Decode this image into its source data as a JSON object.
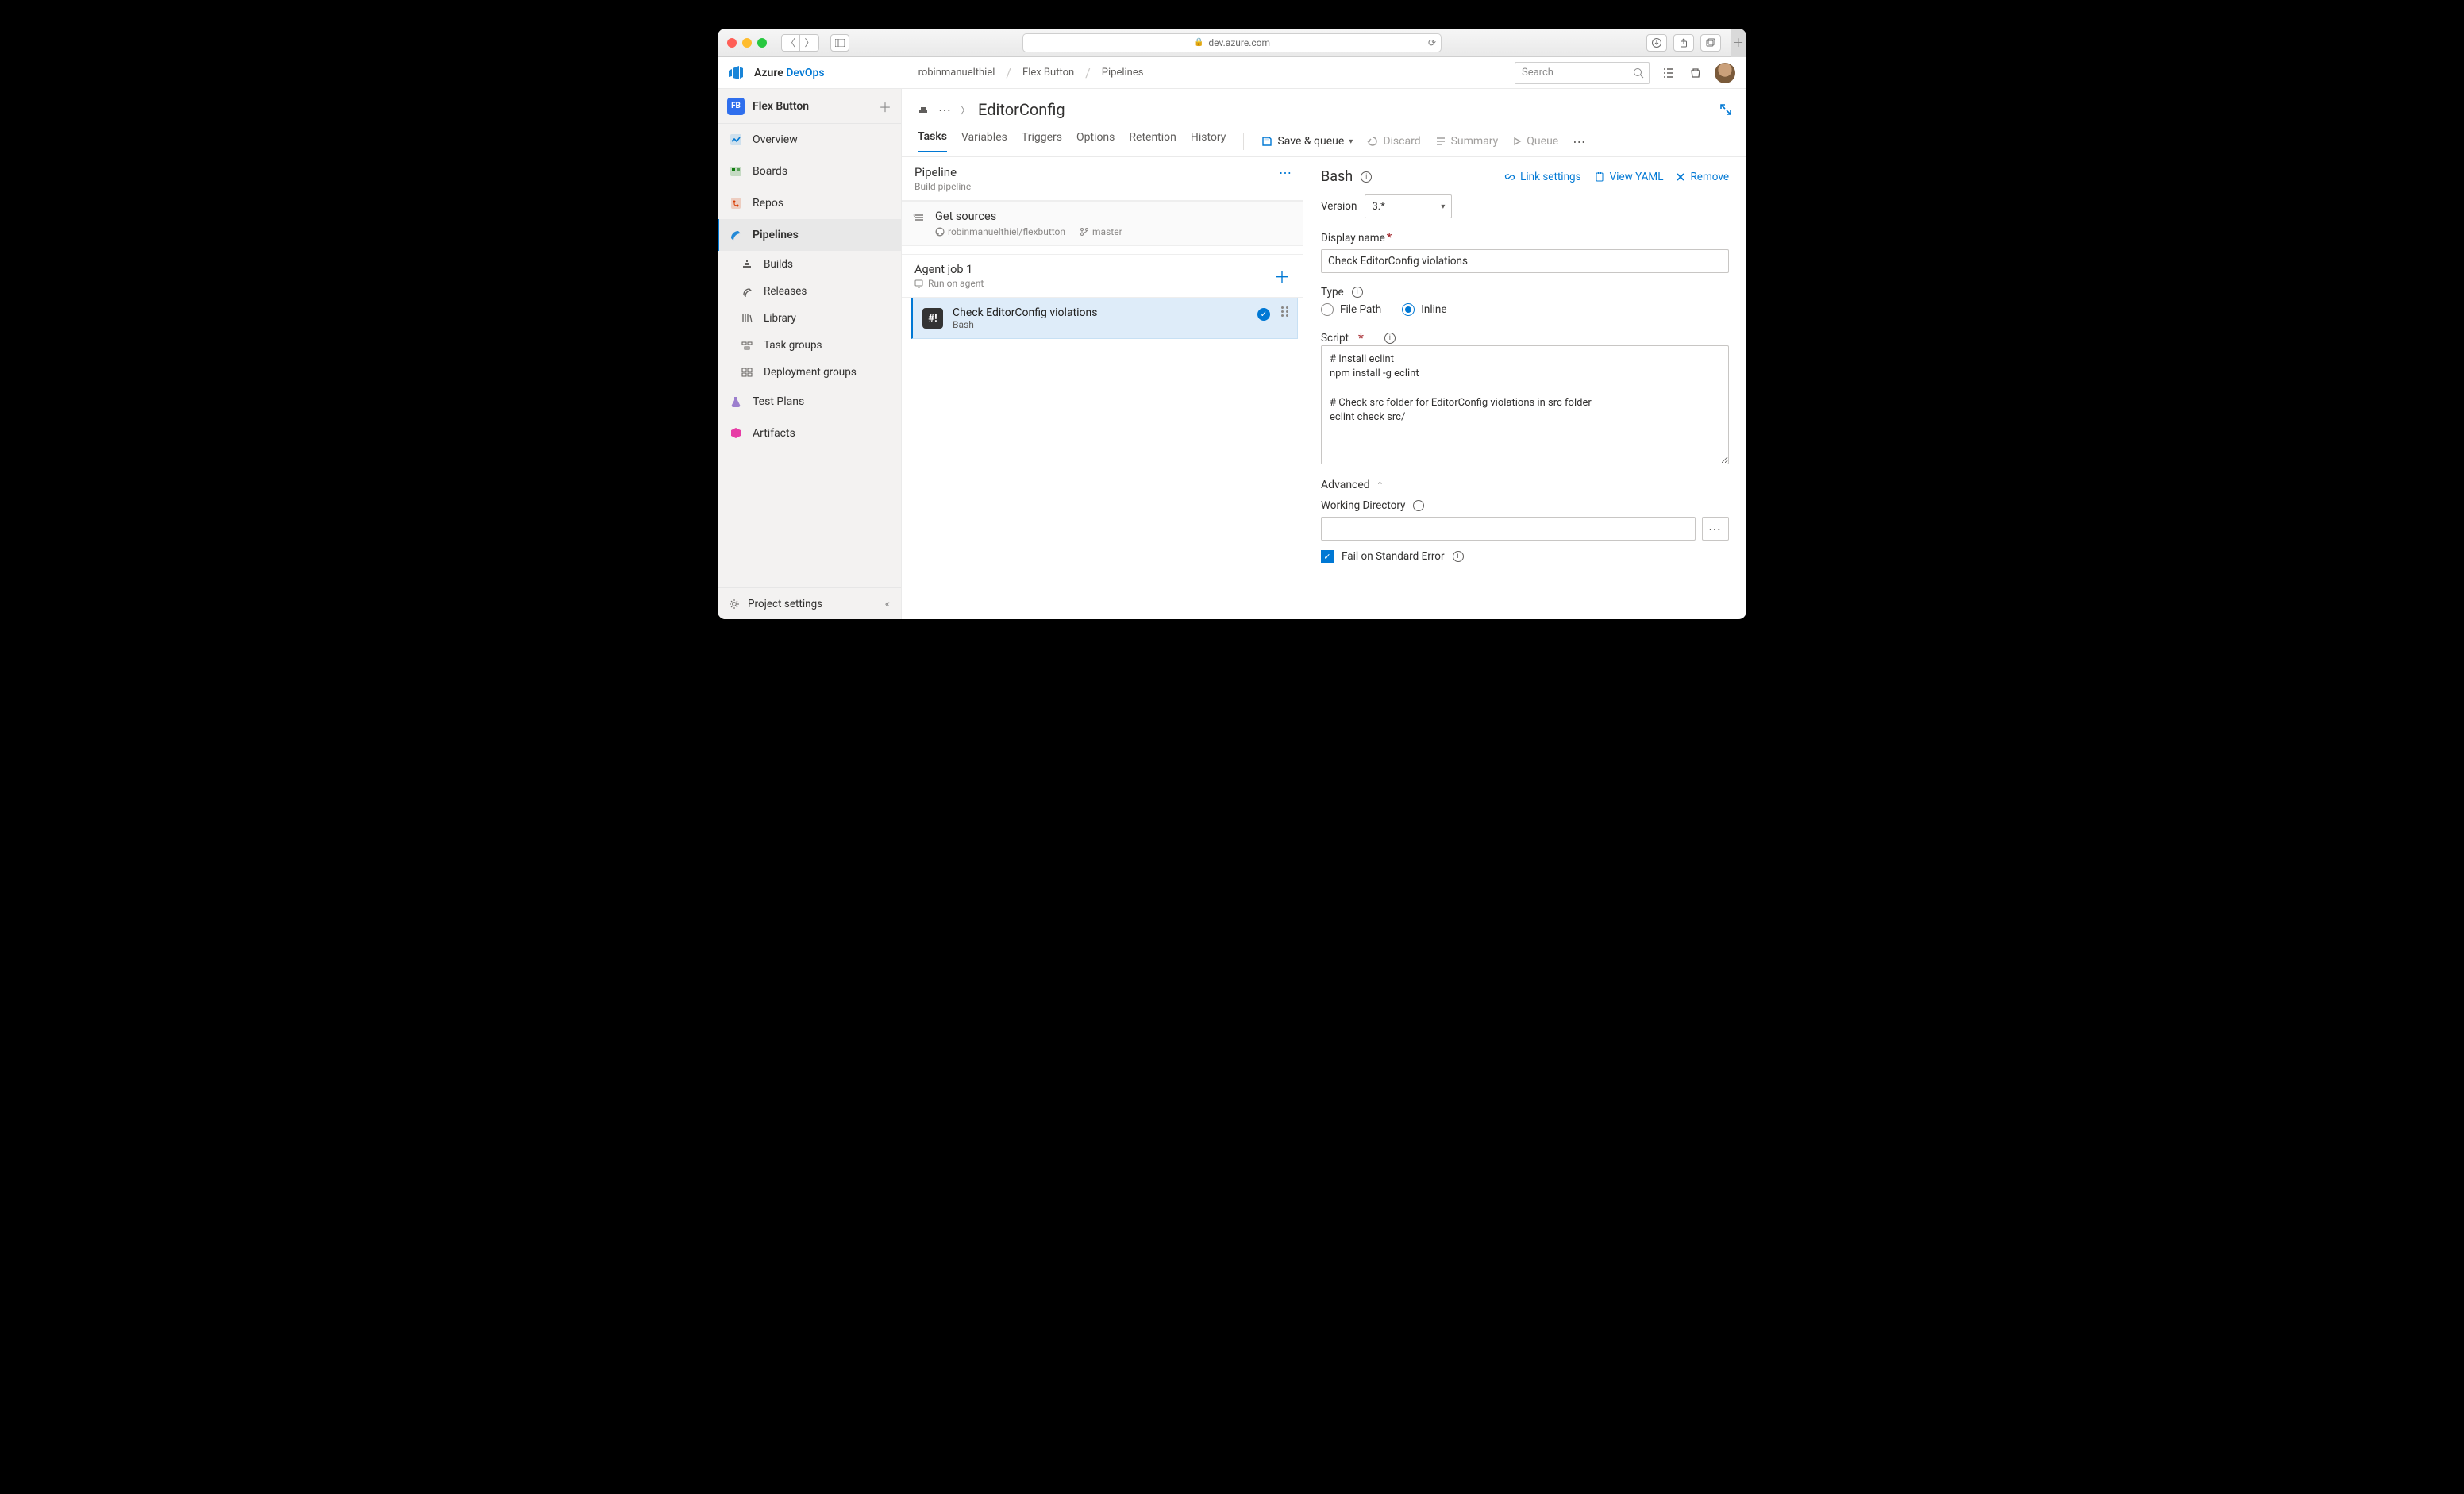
{
  "browser": {
    "url_host": "dev.azure.com"
  },
  "brand": {
    "a": "Azure ",
    "b": "DevOps"
  },
  "breadcrumbs": [
    "robinmanuelthiel",
    "Flex Button",
    "Pipelines"
  ],
  "search": {
    "placeholder": "Search"
  },
  "project": {
    "badge": "FB",
    "name": "Flex Button"
  },
  "nav": {
    "overview": "Overview",
    "boards": "Boards",
    "repos": "Repos",
    "pipelines": "Pipelines",
    "builds": "Builds",
    "releases": "Releases",
    "library": "Library",
    "task_groups": "Task groups",
    "deploy_groups": "Deployment groups",
    "test_plans": "Test Plans",
    "artifacts": "Artifacts",
    "project_settings": "Project settings"
  },
  "page": {
    "title": "EditorConfig"
  },
  "tabs": {
    "tasks": "Tasks",
    "variables": "Variables",
    "triggers": "Triggers",
    "options": "Options",
    "retention": "Retention",
    "history": "History"
  },
  "toolbar": {
    "save_queue": "Save & queue",
    "discard": "Discard",
    "summary": "Summary",
    "queue": "Queue"
  },
  "pipeline": {
    "title": "Pipeline",
    "subtitle": "Build pipeline",
    "get_sources": "Get sources",
    "repo": "robinmanuelthiel/flexbutton",
    "branch": "master",
    "agent_job_title": "Agent job 1",
    "agent_job_sub": "Run on agent",
    "task_title": "Check EditorConfig violations",
    "task_sub": "Bash"
  },
  "pane": {
    "title": "Bash",
    "link_settings": "Link settings",
    "view_yaml": "View YAML",
    "remove": "Remove",
    "version_label": "Version",
    "version_value": "3.*",
    "display_name_label": "Display name",
    "display_name_value": "Check EditorConfig violations",
    "type_label": "Type",
    "type_file": "File Path",
    "type_inline": "Inline",
    "script_label": "Script",
    "script_value": "# Install eclint\nnpm install -g eclint\n\n# Check src folder for EditorConfig violations in src folder\neclint check src/",
    "advanced": "Advanced",
    "workdir_label": "Working Directory",
    "workdir_value": "",
    "fail_on_stderr": "Fail on Standard Error"
  }
}
